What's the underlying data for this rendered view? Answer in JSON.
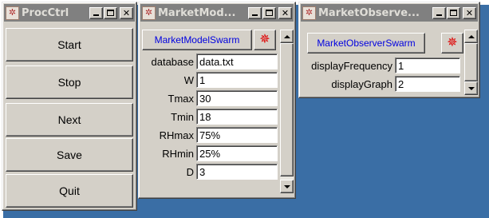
{
  "colors": {
    "desktop": "#3a6ea5",
    "face": "#d4d0c8",
    "titlebar_inactive": "#808080",
    "link_text": "#0000e0",
    "probe_red": "#e00000"
  },
  "proc_ctrl": {
    "title": "ProcCtrl",
    "buttons": [
      "Start",
      "Stop",
      "Next",
      "Save",
      "Quit"
    ]
  },
  "market_model": {
    "title": "MarketMod...",
    "swarm_button": "MarketModelSwarm",
    "fields": [
      {
        "label": "database",
        "value": "data.txt"
      },
      {
        "label": "W",
        "value": "1"
      },
      {
        "label": "Tmax",
        "value": "30"
      },
      {
        "label": "Tmin",
        "value": "18"
      },
      {
        "label": "RHmax",
        "value": "75%"
      },
      {
        "label": "RHmin",
        "value": "25%"
      },
      {
        "label": "D",
        "value": "3"
      }
    ]
  },
  "market_observer": {
    "title": "MarketObserve...",
    "swarm_button": "MarketObserverSwarm",
    "fields": [
      {
        "label": "displayFrequency",
        "value": "1"
      },
      {
        "label": "displayGraph",
        "value": "2"
      }
    ]
  },
  "icons": {
    "window_icon": "swarm-app-icon",
    "probe_icon": "probe-bug-icon",
    "minimize": "minimize-icon",
    "maximize": "maximize-icon",
    "close": "close-icon"
  }
}
